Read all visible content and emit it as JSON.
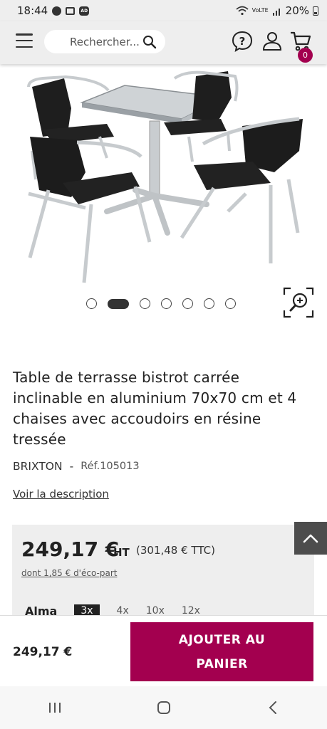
{
  "status": {
    "time": "18:44",
    "icons_left": [
      "globe-icon",
      "newspaper-icon",
      "ad-icon"
    ],
    "ad_badge": "AD",
    "network": "VoLTE",
    "battery": "20%"
  },
  "header": {
    "search_placeholder": "Rechercher...",
    "cart_count": "0"
  },
  "carousel": {
    "total": 7,
    "active_index": 1
  },
  "product": {
    "title": "Table de terrasse bistrot carrée inclinable en aluminium 70x70 cm et 4 chaises avec accoudoirs en résine tressée",
    "brand": "BRIXTON",
    "ref_sep": "-",
    "ref": "Réf.105013",
    "description_link": "Voir la description"
  },
  "price": {
    "main": "249,17 €",
    "ht_label": "HT",
    "ttc": "(301,48 € TTC)",
    "eco": "dont 1,85 € d'éco-part",
    "payment_label": "Alma",
    "installments": [
      "3x",
      "4x",
      "10x",
      "12x"
    ],
    "selected_installment": "3x"
  },
  "footer": {
    "price": "249,17 €",
    "add_line1": "AJOUTER AU",
    "add_line2": "PANIER"
  },
  "colors": {
    "brand": "#a3004f",
    "header_bg": "#eeeeee",
    "scroll_top_bg": "#4d4d4d"
  }
}
